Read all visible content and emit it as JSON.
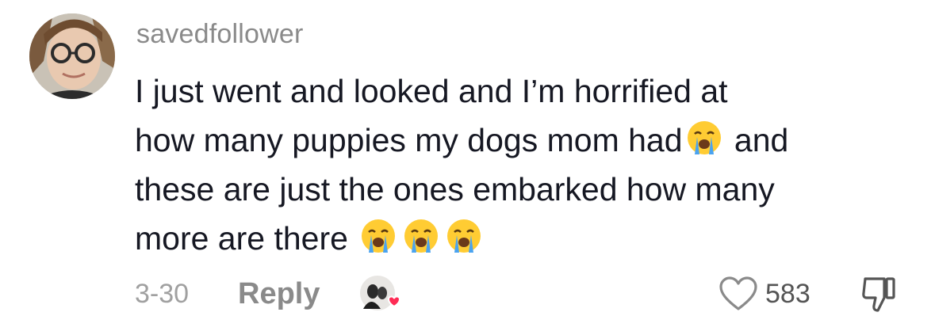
{
  "comment": {
    "username": "savedfollower",
    "lines": [
      "I just went and looked and I’m horrified at",
      "how many puppies my dogs mom had",
      "these are just the ones embarked how many",
      "more are there"
    ],
    "line2_tail": "and",
    "emoji_icon": "loudly-crying-face"
  },
  "footer": {
    "date": "3-30",
    "reply_label": "Reply",
    "like_count": "583",
    "like_icon": "heart-outline-icon",
    "dislike_icon": "thumbs-down-icon",
    "creator_liked_icon": "creator-avatar-heart-icon"
  },
  "colors": {
    "text": "#161823",
    "muted": "#8a8a8a",
    "heart_badge": "#fe2c55"
  }
}
